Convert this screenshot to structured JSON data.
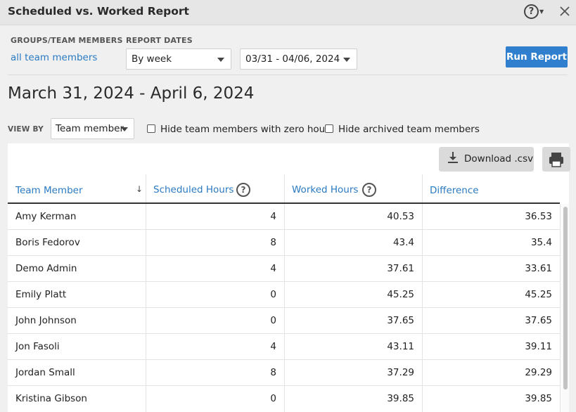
{
  "window": {
    "title": "Scheduled vs. Worked Report",
    "help_label": "?"
  },
  "filters": {
    "groups_label": "GROUPS/TEAM MEMBERS",
    "groups_value": "all team members",
    "dates_label": "REPORT DATES",
    "period_value": "By week",
    "range_value": "03/31 - 04/06, 2024",
    "run_label": "Run Report"
  },
  "report": {
    "heading": "March 31, 2024 - April 6, 2024",
    "view_by_label": "VIEW BY",
    "view_by_value": "Team member",
    "hide_zero_label": "Hide team members with zero hours",
    "hide_archived_label": "Hide archived team members",
    "download_label": "Download .csv",
    "columns": [
      "Team Member",
      "Scheduled Hours",
      "Worked Hours",
      "Difference"
    ],
    "rows": [
      {
        "name": "Amy Kerman",
        "scheduled": "4",
        "worked": "40.53",
        "diff": "36.53"
      },
      {
        "name": "Boris Fedorov",
        "scheduled": "8",
        "worked": "43.4",
        "diff": "35.4"
      },
      {
        "name": "Demo Admin",
        "scheduled": "4",
        "worked": "37.61",
        "diff": "33.61"
      },
      {
        "name": "Emily Platt",
        "scheduled": "0",
        "worked": "45.25",
        "diff": "45.25"
      },
      {
        "name": "John Johnson",
        "scheduled": "0",
        "worked": "37.65",
        "diff": "37.65"
      },
      {
        "name": "Jon Fasoli",
        "scheduled": "4",
        "worked": "43.11",
        "diff": "39.11"
      },
      {
        "name": "Jordan Small",
        "scheduled": "8",
        "worked": "37.29",
        "diff": "29.29"
      },
      {
        "name": "Kristina Gibson",
        "scheduled": "0",
        "worked": "39.85",
        "diff": "39.85"
      }
    ]
  }
}
